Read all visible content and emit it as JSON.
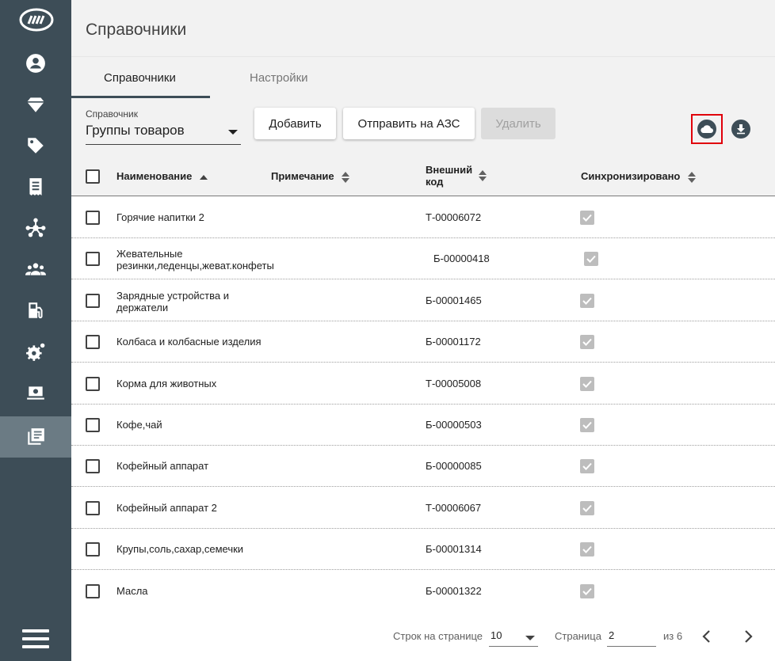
{
  "header": {
    "title": "Справочники"
  },
  "tabs": [
    {
      "label": "Справочники",
      "active": true
    },
    {
      "label": "Настройки",
      "active": false
    }
  ],
  "toolbar": {
    "select_label": "Справочник",
    "select_value": "Группы товаров",
    "add_label": "Добавить",
    "send_label": "Отправить на АЗС",
    "delete_label": "Удалить",
    "sync_icon": "cloud-icon",
    "download_icon": "download-icon"
  },
  "sidebar": {
    "items": [
      {
        "icon": "account-icon"
      },
      {
        "icon": "diamond-icon"
      },
      {
        "icon": "tag-icon"
      },
      {
        "icon": "receipt-icon"
      },
      {
        "icon": "network-icon"
      },
      {
        "icon": "users-icon"
      },
      {
        "icon": "fuel-station-icon"
      },
      {
        "icon": "settings-icon"
      },
      {
        "icon": "money-icon"
      },
      {
        "icon": "catalog-icon",
        "active": true
      }
    ],
    "menu_icon": "menu-icon"
  },
  "table": {
    "columns": {
      "name": "Наименование",
      "note": "Примечание",
      "ext_code_1": "Внешний",
      "ext_code_2": "код",
      "synced": "Синхронизировано"
    },
    "rows": [
      {
        "name": "Горячие напитки 2",
        "code": "Т-00006072",
        "synced": true
      },
      {
        "name": "Жевательные\nрезинки,леденцы,жеват.конфеты",
        "code": "Б-00000418",
        "synced": true
      },
      {
        "name": "Зарядные устройства и\nдержатели",
        "code": "Б-00001465",
        "synced": true
      },
      {
        "name": "Колбаса и колбасные изделия",
        "code": "Б-00001172",
        "synced": true
      },
      {
        "name": "Корма для животных",
        "code": "Т-00005008",
        "synced": true
      },
      {
        "name": "Кофе,чай",
        "code": "Б-00000503",
        "synced": true
      },
      {
        "name": "Кофейный аппарат",
        "code": "Б-00000085",
        "synced": true
      },
      {
        "name": "Кофейный аппарат 2",
        "code": "Т-00006067",
        "synced": true
      },
      {
        "name": "Крупы,соль,сахар,семечки",
        "code": "Б-00001314",
        "synced": true
      },
      {
        "name": "Масла",
        "code": "Б-00001322",
        "synced": true
      }
    ]
  },
  "pager": {
    "rows_label": "Строк на странице",
    "rows_value": "10",
    "page_label": "Страница",
    "page_value": "2",
    "of_label": "из 6"
  },
  "colors": {
    "sidebar": "#3d4d57",
    "sidebar_active": "#6b7b84",
    "highlight": "#e0000b"
  }
}
